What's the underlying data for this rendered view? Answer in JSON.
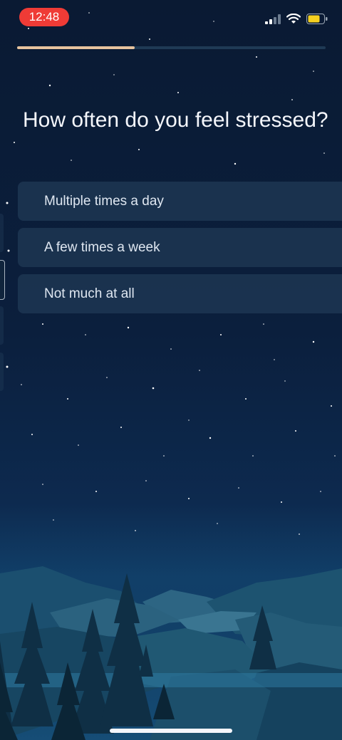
{
  "status_bar": {
    "time": "12:48",
    "signal_icon": "cellular-signal-icon",
    "wifi_icon": "wifi-icon",
    "battery_icon": "battery-icon",
    "time_pill_color": "#ef3b36",
    "battery_color": "#f5d020"
  },
  "progress": {
    "fraction": 0.38,
    "fill_color": "#e6c39e",
    "track_color": "#1f3a55"
  },
  "question": "How often do you feel stressed?",
  "options": [
    {
      "label": "Multiple times a day"
    },
    {
      "label": "A few times a week"
    },
    {
      "label": "Not much at all"
    }
  ],
  "background": {
    "sky_top": "#0a1a33",
    "sky_bottom": "#11406a"
  }
}
